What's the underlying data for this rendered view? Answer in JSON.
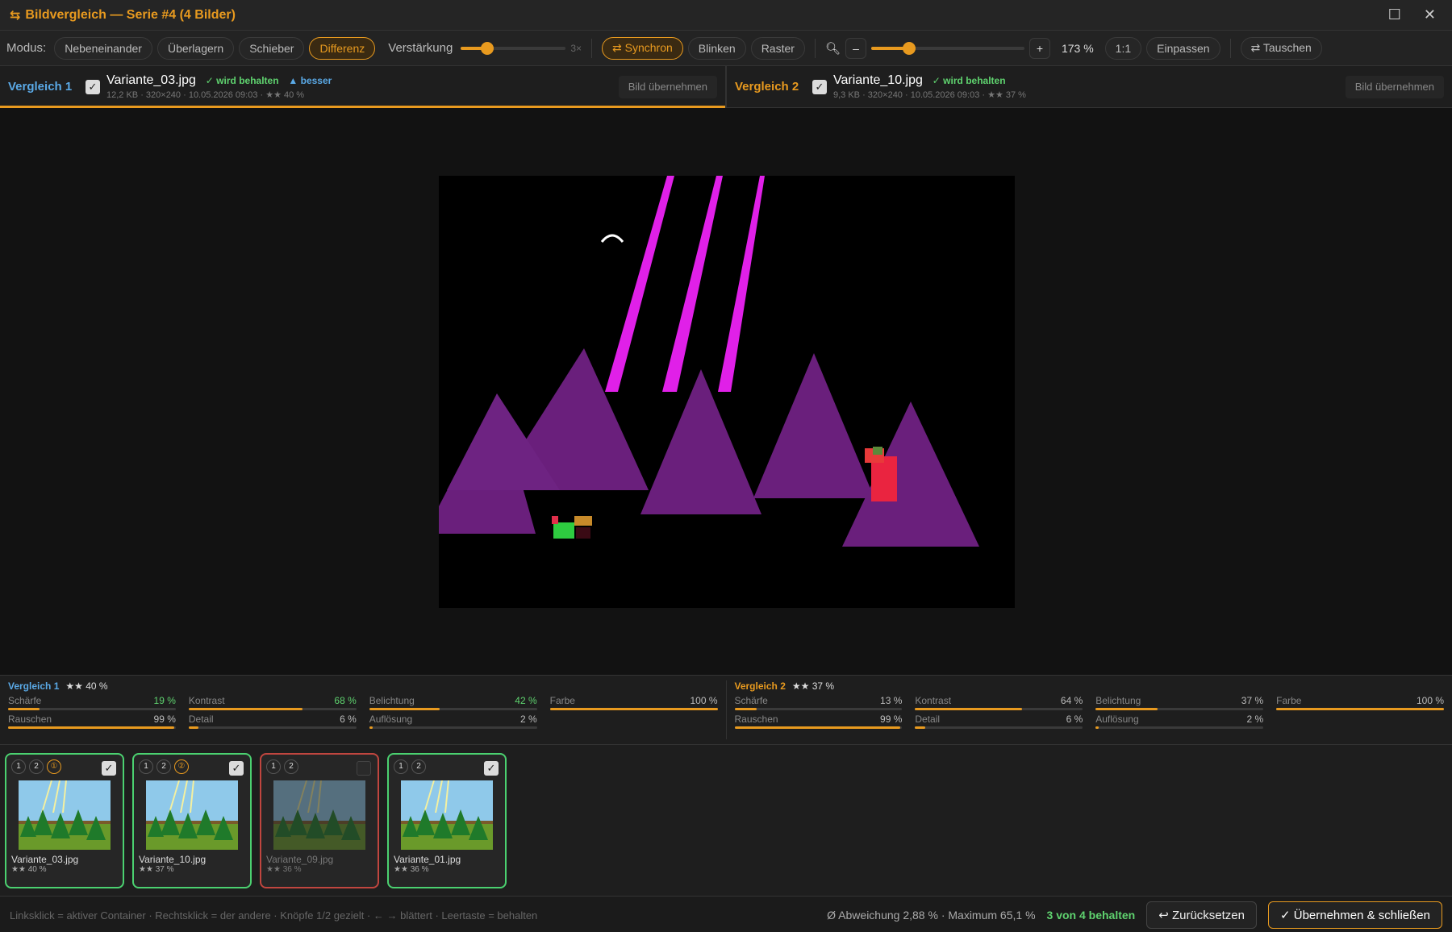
{
  "window": {
    "title": "Bildvergleich — Serie #4 (4 Bilder)",
    "icon": "swap-icon"
  },
  "toolbar": {
    "mode_label": "Modus:",
    "modes": [
      "Nebeneinander",
      "Überlagern",
      "Schieber",
      "Differenz"
    ],
    "active_mode": "Differenz",
    "gain_label": "Verstärkung",
    "gain_value": "3×",
    "gain_level": 0.25,
    "sync_label": "⇄ Synchron",
    "blink_label": "Blinken",
    "grid_label": "Raster",
    "zoom_minus": "–",
    "zoom_plus": "+",
    "zoom_value": "173 %",
    "zoom_level": 0.25,
    "one_to_one": "1:1",
    "fit_label": "Einpassen",
    "swap_label": "⇄ Tauschen"
  },
  "compare": [
    {
      "label": "Vergleich 1",
      "color": "#5aa9e6",
      "file": "Variante_03.jpg",
      "keep": "✓ wird behalten",
      "better": "▲ besser",
      "meta": "12,2 KB · 320×240 · 10.05.2026 09:03 · ★★ 40 %",
      "take": "Bild übernehmen"
    },
    {
      "label": "Vergleich 2",
      "color": "#e89a1f",
      "file": "Variante_10.jpg",
      "keep": "✓ wird behalten",
      "better": "",
      "meta": "9,3 KB · 320×240 · 10.05.2026 09:03 · ★★ 37 %",
      "take": "Bild übernehmen"
    }
  ],
  "stats": [
    {
      "label": "Vergleich 1",
      "score": "★★ 40 %",
      "metrics": [
        {
          "name": "Schärfe",
          "value": "19 %",
          "pct": 19,
          "good": true
        },
        {
          "name": "Kontrast",
          "value": "68 %",
          "pct": 68,
          "good": true
        },
        {
          "name": "Belichtung",
          "value": "42 %",
          "pct": 42,
          "good": true
        },
        {
          "name": "Farbe",
          "value": "100 %",
          "pct": 100,
          "good": false
        },
        {
          "name": "Rauschen",
          "value": "99 %",
          "pct": 99,
          "good": false
        },
        {
          "name": "Detail",
          "value": "6 %",
          "pct": 6,
          "good": false
        },
        {
          "name": "Auflösung",
          "value": "2 %",
          "pct": 2,
          "good": false
        }
      ]
    },
    {
      "label": "Vergleich 2",
      "score": "★★ 37 %",
      "metrics": [
        {
          "name": "Schärfe",
          "value": "13 %",
          "pct": 13,
          "good": false
        },
        {
          "name": "Kontrast",
          "value": "64 %",
          "pct": 64,
          "good": false
        },
        {
          "name": "Belichtung",
          "value": "37 %",
          "pct": 37,
          "good": false
        },
        {
          "name": "Farbe",
          "value": "100 %",
          "pct": 100,
          "good": false
        },
        {
          "name": "Rauschen",
          "value": "99 %",
          "pct": 99,
          "good": false
        },
        {
          "name": "Detail",
          "value": "6 %",
          "pct": 6,
          "good": false
        },
        {
          "name": "Auflösung",
          "value": "2 %",
          "pct": 2,
          "good": false
        }
      ]
    }
  ],
  "thumbnails": [
    {
      "name": "Variante_03.jpg",
      "stars": "★★ 40 %",
      "rank": "1",
      "kept": true
    },
    {
      "name": "Variante_10.jpg",
      "stars": "★★ 37 %",
      "rank": "2",
      "kept": true
    },
    {
      "name": "Variante_09.jpg",
      "stars": "★★ 36 %",
      "rank": "",
      "kept": false
    },
    {
      "name": "Variante_01.jpg",
      "stars": "★★ 36 %",
      "rank": "",
      "kept": true
    }
  ],
  "status": {
    "hint": "Linksklick = aktiver Container · Rechtsklick = der andere · Knöpfe 1/2 gezielt · ← → blättert · Leertaste = behalten",
    "deviation": "Ø Abweichung 2,88 % · Maximum 65,1 %",
    "kept": "3 von 4 behalten",
    "reset": "↩ Zurücksetzen",
    "apply": "✓ Übernehmen & schließen"
  }
}
